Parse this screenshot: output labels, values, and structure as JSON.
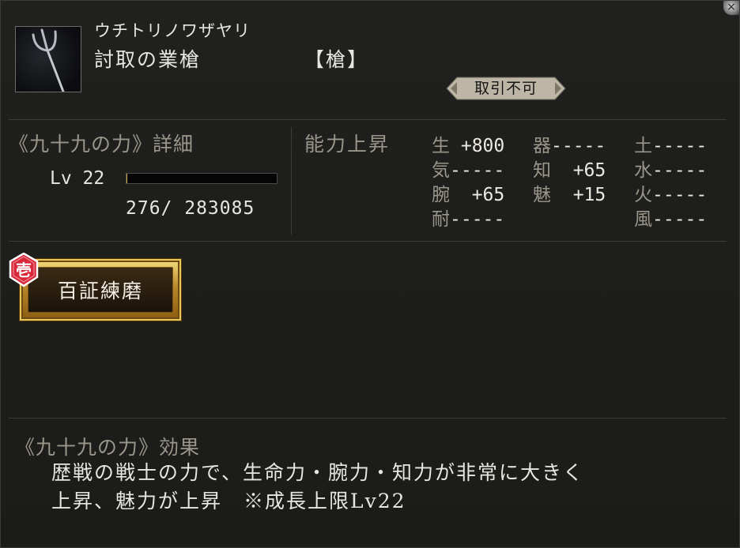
{
  "window": {
    "close_glyph": "×"
  },
  "item": {
    "icon": "trident-spear-icon",
    "reading": "ウチトリノワザヤリ",
    "name": "討取の業槍",
    "category": "【槍】",
    "trade_status": "取引不可"
  },
  "detail": {
    "title": "《九十九の力》詳細",
    "level_label": "Lv 22",
    "exp_text": "276/  283085",
    "exp_fraction": 0.001
  },
  "stats": {
    "title": "能力上昇",
    "entries": [
      {
        "key": "生",
        "value": " +800"
      },
      {
        "key": "器",
        "value": "-----"
      },
      {
        "key": "土",
        "value": "-----"
      },
      {
        "key": "気",
        "value": "-----"
      },
      {
        "key": "知",
        "value": "  +65"
      },
      {
        "key": "水",
        "value": "-----"
      },
      {
        "key": "腕",
        "value": "  +65"
      },
      {
        "key": "魅",
        "value": "  +15"
      },
      {
        "key": "火",
        "value": "-----"
      },
      {
        "key": "耐",
        "value": "-----"
      },
      {
        "key": "風",
        "value": "-----"
      }
    ]
  },
  "skill": {
    "rank": "壱",
    "name": "百証練磨"
  },
  "effect": {
    "title": "《九十九の力》効果",
    "line1": "歴戦の戦士の力で、生命力・腕力・知力が非常に大きく",
    "line2": "上昇、魅力が上昇　※成長上限Lv22"
  },
  "colors": {
    "background": "#1d1d1b",
    "label_gray": "#9a968b",
    "text": "#e8e6e0",
    "gold": "#c9a84a",
    "seal_red": "#d8283a"
  }
}
